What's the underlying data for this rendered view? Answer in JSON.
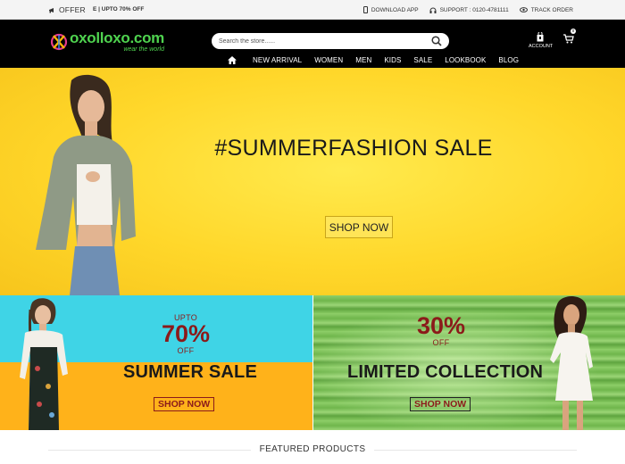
{
  "topbar": {
    "offer_label": "OFFER",
    "promo_text": "E | UPTO 70% OFF",
    "download_app": "DOWNLOAD APP",
    "support": "SUPPORT : 0120-4781111",
    "track_order": "TRACK ORDER"
  },
  "header": {
    "logo_main": "oxolloxo.com",
    "logo_tagline": "wear the world",
    "search_placeholder": "Search the store......",
    "account_label": "ACCOUNT",
    "cart_count": "0",
    "nav": [
      "NEW ARRIVAL",
      "WOMEN",
      "MEN",
      "KIDS",
      "SALE",
      "LOOKBOOK",
      "BLOG"
    ]
  },
  "hero": {
    "title": "#SUMMERFASHION SALE",
    "cta": "SHOP NOW"
  },
  "promo_left": {
    "upto": "UPTO",
    "percent": "70%",
    "off": "OFF",
    "title": "SUMMER SALE",
    "cta": "SHOP NOW"
  },
  "promo_right": {
    "percent": "30%",
    "off": "OFF",
    "title": "LIMITED COLLECTION",
    "cta": "SHOP NOW"
  },
  "featured": {
    "label": "FEATURED PRODUCTS"
  },
  "colors": {
    "header_bg": "#000000",
    "logo_green": "#4fd34f",
    "hero_yellow": "#ffd72a",
    "sale_red": "#8b1a1a",
    "cyan": "#3fd4e6",
    "orange": "#ffb21a",
    "green": "#6fb64c"
  }
}
